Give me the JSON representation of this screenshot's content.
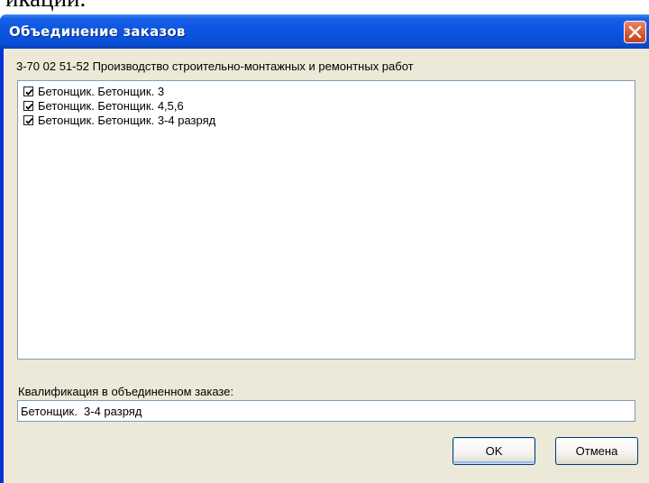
{
  "document_fragment": "икации.",
  "dialog": {
    "title": "Объединение заказов",
    "header": "3-70 02 51-52 Производство строительно-монтажных и ремонтных работ",
    "items": [
      {
        "label": "Бетонщик. Бетонщик. 3",
        "checked": true
      },
      {
        "label": "Бетонщик. Бетонщик. 4,5,6",
        "checked": true
      },
      {
        "label": "Бетонщик. Бетонщик. 3-4 разряд",
        "checked": true
      }
    ],
    "qualification_label": "Квалификация в объединенном заказе:",
    "qualification_value": "Бетонщик.  3-4 разряд",
    "ok_label": "OK",
    "cancel_label": "Отмена"
  },
  "icons": {
    "close": "close-icon",
    "check": "checkmark-icon"
  },
  "colors": {
    "titlebar": "#0a4fd6",
    "client": "#ece9d8",
    "close_button": "#d65a36",
    "input_border": "#7f9db9"
  }
}
